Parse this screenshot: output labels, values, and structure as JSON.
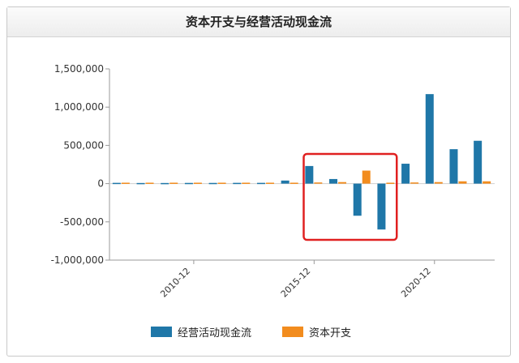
{
  "chart_data": {
    "type": "bar",
    "title": "资本开支与经营活动现金流",
    "xlabel": "",
    "ylabel": "",
    "ylim": [
      -1000000,
      1500000
    ],
    "yticks": [
      "1,500,000",
      "1,000,000",
      "500,000",
      "0",
      "-500,000",
      "-1,000,000"
    ],
    "ytick_values": [
      1500000,
      1000000,
      500000,
      0,
      -500000,
      -1000000
    ],
    "categories": [
      "2007-12",
      "2008-12",
      "2009-12",
      "2010-12",
      "2011-12",
      "2012-12",
      "2013-12",
      "2014-12",
      "2015-12",
      "2016-12",
      "2017-12",
      "2018-12",
      "2019-12",
      "2020-12",
      "2021-12",
      "2022-12"
    ],
    "xtick_labels": [
      {
        "category": "2010-12",
        "label": "2010-12"
      },
      {
        "category": "2015-12",
        "label": "2015-12"
      },
      {
        "category": "2020-12",
        "label": "2020-12"
      }
    ],
    "series": [
      {
        "name": "经营活动现金流",
        "color": "#1f77a8",
        "values": [
          10000,
          8000,
          8000,
          9000,
          9000,
          10000,
          10000,
          40000,
          230000,
          60000,
          -420000,
          -600000,
          260000,
          1170000,
          450000,
          560000
        ]
      },
      {
        "name": "资本开支",
        "color": "#f28c1e",
        "values": [
          12000,
          12000,
          12000,
          12000,
          12000,
          12000,
          12000,
          12000,
          15000,
          20000,
          170000,
          12000,
          15000,
          20000,
          30000,
          30000
        ]
      }
    ],
    "grid": false,
    "legend_position": "bottom",
    "annotation": {
      "type": "highlight-box",
      "color": "#e02020",
      "range": [
        "2015-12",
        "2018-12"
      ]
    }
  }
}
